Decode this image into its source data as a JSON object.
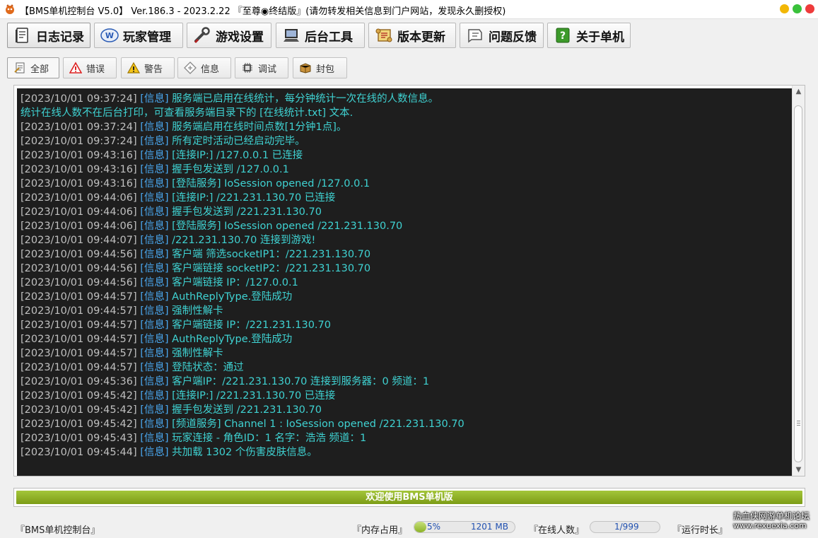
{
  "window": {
    "title": "【BMS单机控制台 V5.0】 Ver.186.3 - 2023.2.22 『至尊◉终结版』(请勿转发相关信息到门户网站，发现永久删授权)",
    "controls": {
      "minimize_color": "#f2b705",
      "maximize_color": "#39c13b",
      "close_color": "#ee3b3b"
    }
  },
  "main_tabs": [
    {
      "label": "日志记录",
      "icon": "notebook-icon",
      "active": true
    },
    {
      "label": "玩家管理",
      "icon": "word-doc-icon",
      "active": false
    },
    {
      "label": "游戏设置",
      "icon": "wrench-icon",
      "active": false
    },
    {
      "label": "后台工具",
      "icon": "computer-icon",
      "active": false
    },
    {
      "label": "版本更新",
      "icon": "scroll-icon",
      "active": false
    },
    {
      "label": "问题反馈",
      "icon": "chat-bubble-icon",
      "active": false
    },
    {
      "label": "关于单机",
      "icon": "help-icon",
      "active": false
    }
  ],
  "log_filter_tabs": [
    {
      "label": "全部",
      "icon": "all-log-icon",
      "active": true
    },
    {
      "label": "错误",
      "icon": "error-triangle-icon",
      "active": false
    },
    {
      "label": "警告",
      "icon": "warning-triangle-icon",
      "active": false
    },
    {
      "label": "信息",
      "icon": "info-diamond-icon",
      "active": false
    },
    {
      "label": "调试",
      "icon": "debug-chip-icon",
      "active": false
    },
    {
      "label": "封包",
      "icon": "packet-box-icon",
      "active": false
    }
  ],
  "console": {
    "colors": {
      "background": "#1e1e1e",
      "timestamp": "#c0c0c0",
      "level": "#4aa8f0",
      "message": "#3fd2d2"
    },
    "lines": [
      {
        "ts": "[2023/10/01 09:37:24]",
        "level": "[信息]",
        "msg": "服务端已启用在线统计，每分钟统计一次在线的人数信息。"
      },
      {
        "ts": "",
        "level": "",
        "msg": "统计在线人数不在后台打印，可查看服务端目录下的 [在线统计.txt] 文本."
      },
      {
        "ts": "[2023/10/01 09:37:24]",
        "level": "[信息]",
        "msg": "服务端启用在线时间点数[1分钟1点]。"
      },
      {
        "ts": "[2023/10/01 09:37:24]",
        "level": "[信息]",
        "msg": "所有定时活动已经启动完毕。"
      },
      {
        "ts": "[2023/10/01 09:43:16]",
        "level": "[信息]",
        "msg": "[连接IP:] /127.0.0.1 已连接"
      },
      {
        "ts": "[2023/10/01 09:43:16]",
        "level": "[信息]",
        "msg": "握手包发送到 /127.0.0.1"
      },
      {
        "ts": "[2023/10/01 09:43:16]",
        "level": "[信息]",
        "msg": "[登陆服务] IoSession opened /127.0.0.1"
      },
      {
        "ts": "[2023/10/01 09:44:06]",
        "level": "[信息]",
        "msg": "[连接IP:] /221.231.130.70 已连接"
      },
      {
        "ts": "[2023/10/01 09:44:06]",
        "level": "[信息]",
        "msg": "握手包发送到 /221.231.130.70"
      },
      {
        "ts": "[2023/10/01 09:44:06]",
        "level": "[信息]",
        "msg": "[登陆服务] IoSession opened /221.231.130.70"
      },
      {
        "ts": "[2023/10/01 09:44:07]",
        "level": "[信息]",
        "msg": "/221.231.130.70 连接到游戏!"
      },
      {
        "ts": "[2023/10/01 09:44:56]",
        "level": "[信息]",
        "msg": "客户端 筛选socketIP1：/221.231.130.70"
      },
      {
        "ts": "[2023/10/01 09:44:56]",
        "level": "[信息]",
        "msg": "客户端链接 socketIP2：/221.231.130.70"
      },
      {
        "ts": "[2023/10/01 09:44:56]",
        "level": "[信息]",
        "msg": "客户端链接 IP：/127.0.0.1"
      },
      {
        "ts": "[2023/10/01 09:44:57]",
        "level": "[信息]",
        "msg": "AuthReplyType.登陆成功"
      },
      {
        "ts": "[2023/10/01 09:44:57]",
        "level": "[信息]",
        "msg": "强制性解卡"
      },
      {
        "ts": "[2023/10/01 09:44:57]",
        "level": "[信息]",
        "msg": "客户端链接 IP：/221.231.130.70"
      },
      {
        "ts": "[2023/10/01 09:44:57]",
        "level": "[信息]",
        "msg": "AuthReplyType.登陆成功"
      },
      {
        "ts": "[2023/10/01 09:44:57]",
        "level": "[信息]",
        "msg": "强制性解卡"
      },
      {
        "ts": "[2023/10/01 09:44:57]",
        "level": "[信息]",
        "msg": "登陆状态：通过"
      },
      {
        "ts": "[2023/10/01 09:45:36]",
        "level": "[信息]",
        "msg": "客户端IP：/221.231.130.70 连接到服务器：0 频道：1"
      },
      {
        "ts": "[2023/10/01 09:45:42]",
        "level": "[信息]",
        "msg": "[连接IP:] /221.231.130.70 已连接"
      },
      {
        "ts": "[2023/10/01 09:45:42]",
        "level": "[信息]",
        "msg": "握手包发送到 /221.231.130.70"
      },
      {
        "ts": "[2023/10/01 09:45:42]",
        "level": "[信息]",
        "msg": "[频道服务] Channel 1 : IoSession opened /221.231.130.70"
      },
      {
        "ts": "[2023/10/01 09:45:43]",
        "level": "[信息]",
        "msg": "玩家连接 - 角色ID：1 名字：浩浩 频道：1"
      },
      {
        "ts": "[2023/10/01 09:45:44]",
        "level": "[信息]",
        "msg": "共加载 1302 个伤害皮肤信息。"
      }
    ]
  },
  "welcome_bar": {
    "text": "欢迎使用BMS单机版",
    "color": "#8cb227"
  },
  "status": {
    "app_label": "『BMS单机控制台』",
    "memory_label": "『内存占用』",
    "memory_percent_text": "5%",
    "memory_fraction": 0.05,
    "memory_value": "1201 MB",
    "online_label": "『在线人数』",
    "online_value": "1/999",
    "runtime_label": "『运行时长』"
  },
  "watermark": {
    "line1": "热血侠网游单机论坛",
    "line2": "www.rexuexia.com"
  }
}
